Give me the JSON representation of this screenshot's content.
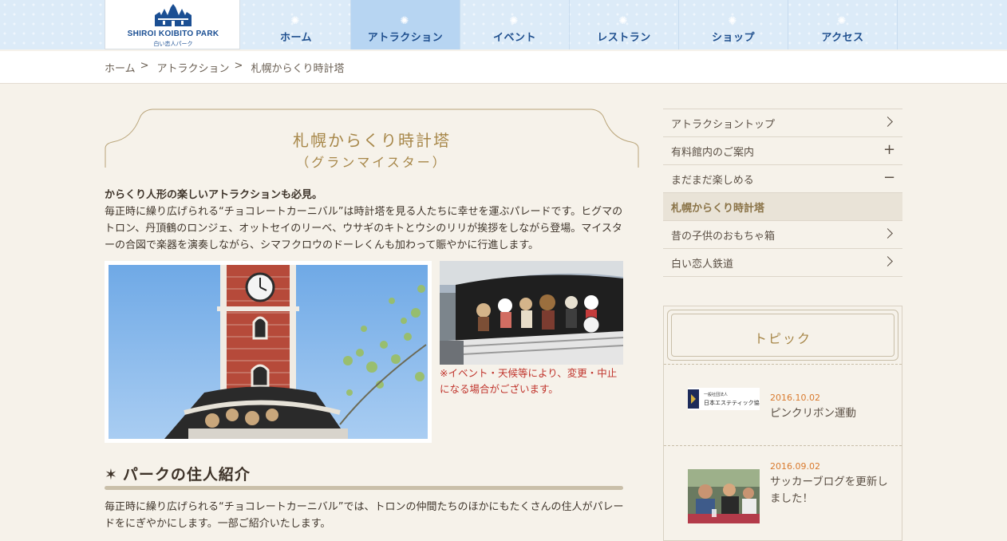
{
  "header": {
    "logo_text": "SHIROI KOIBITO PARK",
    "logo_sub": "白い恋人パーク",
    "nav": [
      {
        "label": "ホーム",
        "active": false
      },
      {
        "label": "アトラクション",
        "active": true
      },
      {
        "label": "イベント",
        "active": false
      },
      {
        "label": "レストラン",
        "active": false
      },
      {
        "label": "ショップ",
        "active": false
      },
      {
        "label": "アクセス",
        "active": false
      }
    ]
  },
  "breadcrumb": {
    "items": [
      "ホーム",
      "アトラクション",
      "札幌からくり時計塔"
    ],
    "separator": ">"
  },
  "main": {
    "title": "札幌からくり時計塔",
    "subtitle": "（グランマイスター）",
    "lead_bold": "からくり人形の楽しいアトラクションも必見。",
    "lead_text": "毎正時に繰り広げられる“チョコレートカーニバル”は時計塔を見る人たちに幸せを運ぶパレードです。ヒグマのトロン、丹頂鶴のロンジェ、オットセイのリーベ、ウサギのキトとウシのリリが挨拶をしながら登場。マイスターの合図で楽器を演奏しながら、シマフクロウのドーレくんも加わって賑やかに行進します。",
    "caption": "※イベント・天候等により、変更・中止になる場合がございます。",
    "section_mark": "✶",
    "section_heading": "パークの住人紹介",
    "section_text": "毎正時に繰り広げられる“チョコレートカーニバル”では、トロンの仲間たちのほかにもたくさんの住人がパレードをにぎやかにします。一部ご紹介いたします。"
  },
  "side_menu": [
    {
      "label": "アトラクショントップ",
      "icon": "chevron-right-icon"
    },
    {
      "label": "有料館内のご案内",
      "icon": "plus-icon"
    },
    {
      "label": "まだまだ楽しめる",
      "icon": "minus-icon"
    },
    {
      "label": "札幌からくり時計塔",
      "icon": "",
      "current": true
    },
    {
      "label": "昔の子供のおもちゃ箱",
      "icon": "chevron-right-icon"
    },
    {
      "label": "白い恋人鉄道",
      "icon": "chevron-right-icon"
    }
  ],
  "topics": {
    "title": "トピック",
    "items": [
      {
        "date": "2016.10.02",
        "text": "ピンクリボン運動",
        "thumb_text_small": "一般社団法人",
        "thumb_text": "日本エステティック協会"
      },
      {
        "date": "2016.09.02",
        "text": "サッカーブログを更新しました！"
      }
    ]
  },
  "colors": {
    "header_bg": "#dcebf8",
    "nav_active": "#b7d5f2",
    "nav_text": "#1f4f8e",
    "accent_gold": "#a78749",
    "caption_red": "#c0342c",
    "date_orange": "#d97a2e",
    "page_bg": "#f6f2ea"
  }
}
